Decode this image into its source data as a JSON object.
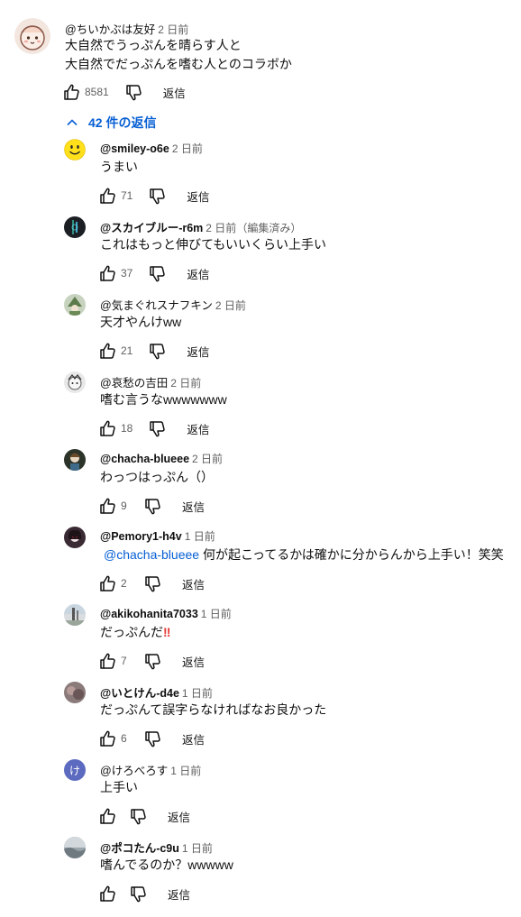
{
  "top": {
    "author": "@ちいかぶは友好",
    "time": "2 日前",
    "line1": "大自然でうっぷんを晴らす人と",
    "line2": "大自然でだっぷんを嗜む人とのコラボか",
    "likes": "8581",
    "reply_label": "返信"
  },
  "toggle_label": "42 件の返信",
  "replies": [
    {
      "author": "@smiley-o6e",
      "time": "2 日前",
      "text": "うまい",
      "likes": "71",
      "reply_label": "返信"
    },
    {
      "author": "@スカイブルー-r6m",
      "time": "2 日前",
      "edited": "（編集済み）",
      "text": "これはもっと伸びてもいいくらい上手い",
      "likes": "37",
      "reply_label": "返信"
    },
    {
      "author": "@気まぐれスナフキン",
      "time": "2 日前",
      "text": "天才やんけww",
      "likes": "21",
      "reply_label": "返信"
    },
    {
      "author": "@哀愁の吉田",
      "time": "2 日前",
      "text": "嗜む言うなwwwwwww",
      "likes": "18",
      "reply_label": "返信"
    },
    {
      "author": "@chacha-blueee",
      "time": "2 日前",
      "text": "わっつはっぷん（）",
      "likes": "9",
      "reply_label": "返信"
    },
    {
      "author": "@Pemory1-h4v",
      "time": "1 日前",
      "mention": "@chacha-blueee",
      "text": " 何が起こってるかは確かに分からんから上手い！笑笑",
      "likes": "2",
      "reply_label": "返信"
    },
    {
      "author": "@akikohanita7033",
      "time": "1 日前",
      "text": "だっぷんだ",
      "emoji": "‼",
      "likes": "7",
      "reply_label": "返信"
    },
    {
      "author": "@いとけん-d4e",
      "time": "1 日前",
      "text": "だっぷんて誤字らなければなお良かった",
      "likes": "6",
      "reply_label": "返信"
    },
    {
      "author": "@けろべろす",
      "time": "1 日前",
      "text": "上手い",
      "likes": "",
      "reply_label": "返信",
      "avatar_letter": "け"
    },
    {
      "author": "@ポコたん-c9u",
      "time": "1 日前",
      "text": "嗜んでるのか？wwwww",
      "likes": "",
      "reply_label": "返信"
    }
  ],
  "colors": {
    "link": "#065fd4",
    "meta": "#606060",
    "avatar_ke": "#5c6bc0",
    "emoji_red": "#e53935"
  }
}
